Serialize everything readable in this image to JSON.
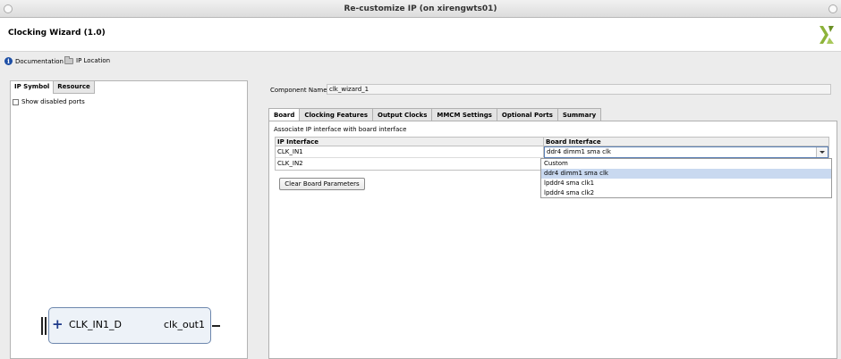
{
  "window": {
    "title": "Re-customize IP (on xirengwts01)"
  },
  "header": {
    "title": "Clocking Wizard (1.0)",
    "logo_icon": "xilinx-logo"
  },
  "links": {
    "documentation": "Documentation",
    "ip_location": "IP Location"
  },
  "left_panel": {
    "tabs": [
      "IP Symbol",
      "Resource"
    ],
    "show_disabled_ports": "Show disabled ports",
    "symbol": {
      "input_port": "CLK_IN1_D",
      "output_port": "clk_out1"
    }
  },
  "component": {
    "label": "Component Name",
    "value": "clk_wizard_1"
  },
  "config_tabs": [
    "Board",
    "Clocking Features",
    "Output Clocks",
    "MMCM Settings",
    "Optional Ports",
    "Summary"
  ],
  "board": {
    "description": "Associate IP interface with board interface",
    "columns": [
      "IP Interface",
      "Board Interface"
    ],
    "rows": [
      {
        "ip_interface": "CLK_IN1",
        "board_interface": "ddr4 dimm1 sma clk"
      },
      {
        "ip_interface": "CLK_IN2",
        "board_interface": ""
      }
    ],
    "dropdown_options": [
      "Custom",
      "ddr4 dimm1 sma clk",
      "lpddr4 sma clk1",
      "lpddr4 sma clk2"
    ],
    "clear_button": "Clear Board Parameters"
  },
  "colors": {
    "accent": "#5a7fb5",
    "selection": "#c9d9f0",
    "logo_green": "#8db33a"
  }
}
